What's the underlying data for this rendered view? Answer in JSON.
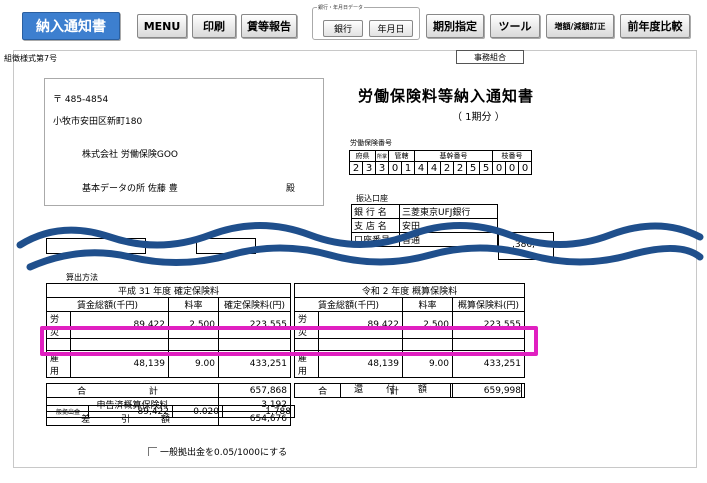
{
  "toolbar": {
    "active": "納入通知書",
    "menu": "MENU",
    "print": "印刷",
    "wage_report": "賃等報告",
    "group_caption": "銀行・年月日データ",
    "bank": "銀行",
    "date": "年月日",
    "period": "期別指定",
    "tools": "ツール",
    "correction": "増額/減額訂正",
    "prev_compare": "前年度比較"
  },
  "doc": {
    "form_no": "組徴様式第7号",
    "office_label": "事務組合",
    "postal": "〒 485-4854",
    "address": "小牧市安田区新町180",
    "company": "株式会社 労働保険GOO",
    "recipient": "基本データの所 佐藤 豊",
    "honorific": "殿",
    "title": "労働保険料等納入通知書",
    "period": "（ 1期分 ）",
    "ins_no_label": "労働保険番号",
    "ins_headers": [
      "府県",
      "所掌",
      "管轄",
      "基幹番号",
      "枝番号"
    ],
    "ins_digits": [
      "2",
      "3",
      "3",
      "0",
      "1",
      "4",
      "4",
      "2",
      "2",
      "5",
      "5",
      "0",
      "0",
      "0"
    ],
    "bank_label": "振込口座",
    "bank_rows": [
      {
        "k": "銀 行 名",
        "v": "三菱東京UFJ銀行"
      },
      {
        "k": "支 店 名",
        "v": "安田"
      },
      {
        "k": "口座番号",
        "v": "普通"
      }
    ],
    "partial_amount": ",386,",
    "calc_label": "算出方法",
    "left_header": "平成 31 年度 確定保険料",
    "right_header": "令和 2 年度 概算保険料",
    "left_cols": [
      "賃金総額(千円)",
      "料率",
      "確定保険料(円)"
    ],
    "right_cols": [
      "賃金総額(千円)",
      "料率",
      "概算保険料(円)"
    ],
    "row1": {
      "label": "労 災",
      "l_wage": "89,422",
      "l_rate": "2.500",
      "l_amt": "223,555",
      "r_wage": "89,422",
      "r_rate": "2.500",
      "r_amt": "223,555"
    },
    "row3": {
      "label": "雇 用",
      "l_wage": "48,139",
      "l_rate": "9.00",
      "l_amt": "433,251",
      "r_wage": "48,139",
      "r_rate": "9.00",
      "r_amt": "433,251"
    },
    "total_label": "合 計",
    "total_left": "657,868",
    "total_right": "659,998",
    "declared_label": "申告済概算保険料",
    "declared": "3,192",
    "diff_label": "差 引 額",
    "diff": "654,676",
    "refund_label": "還 付 額",
    "general_label": "一般拠出金",
    "general_wage": "89,422",
    "general_rate": "0.020",
    "general_amt": "1,788",
    "checkbox_label": "一般拠出金を0.05/1000にする"
  },
  "colors": {
    "active_tab": "#3d7fcf",
    "highlight": "#e020c0",
    "wave": "#1f4f8c"
  }
}
